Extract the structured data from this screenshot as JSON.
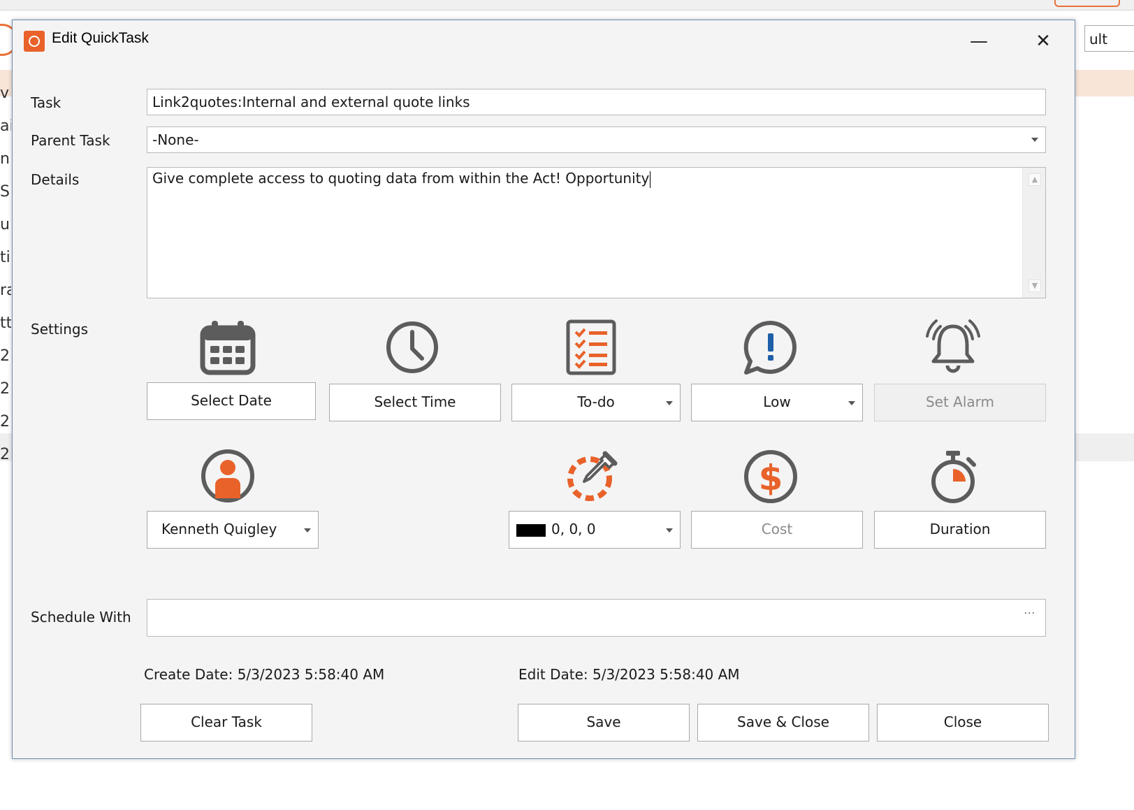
{
  "background": {
    "letters": [
      "v",
      "ai",
      "np",
      "S",
      "up",
      "ti",
      "ra",
      "tti",
      "2",
      "2",
      "2",
      "2"
    ],
    "right_button_label": "ult"
  },
  "dialog": {
    "title": "Edit QuickTask",
    "minimize_glyph": "—",
    "close_glyph": "✕"
  },
  "form": {
    "task_label": "Task",
    "task_value": "Link2quotes:Internal and external quote links",
    "parent_label": "Parent Task",
    "parent_value": "-None-",
    "details_label": "Details",
    "details_value": "Give complete access to quoting data from within the Act! Opportunity",
    "settings_label": "Settings",
    "schedule_label": "Schedule With",
    "schedule_value": "",
    "schedule_ellipsis": "···"
  },
  "settings": {
    "date_button": "Select Date",
    "time_button": "Select Time",
    "type_value": "To-do",
    "priority_value": "Low",
    "alarm_button": "Set Alarm",
    "user_value": "Kenneth Quigley",
    "color_value": "0, 0, 0",
    "color_swatch": "#000000",
    "cost_button": "Cost",
    "duration_button": "Duration"
  },
  "meta": {
    "create_date": "Create Date: 5/3/2023 5:58:40 AM",
    "edit_date": "Edit Date: 5/3/2023 5:58:40 AM"
  },
  "actions": {
    "clear": "Clear Task",
    "save": "Save",
    "save_close": "Save & Close",
    "close": "Close"
  },
  "colors": {
    "accent_orange": "#e8622a",
    "icon_gray": "#5c5c5c",
    "info_blue": "#1f5fa8"
  }
}
